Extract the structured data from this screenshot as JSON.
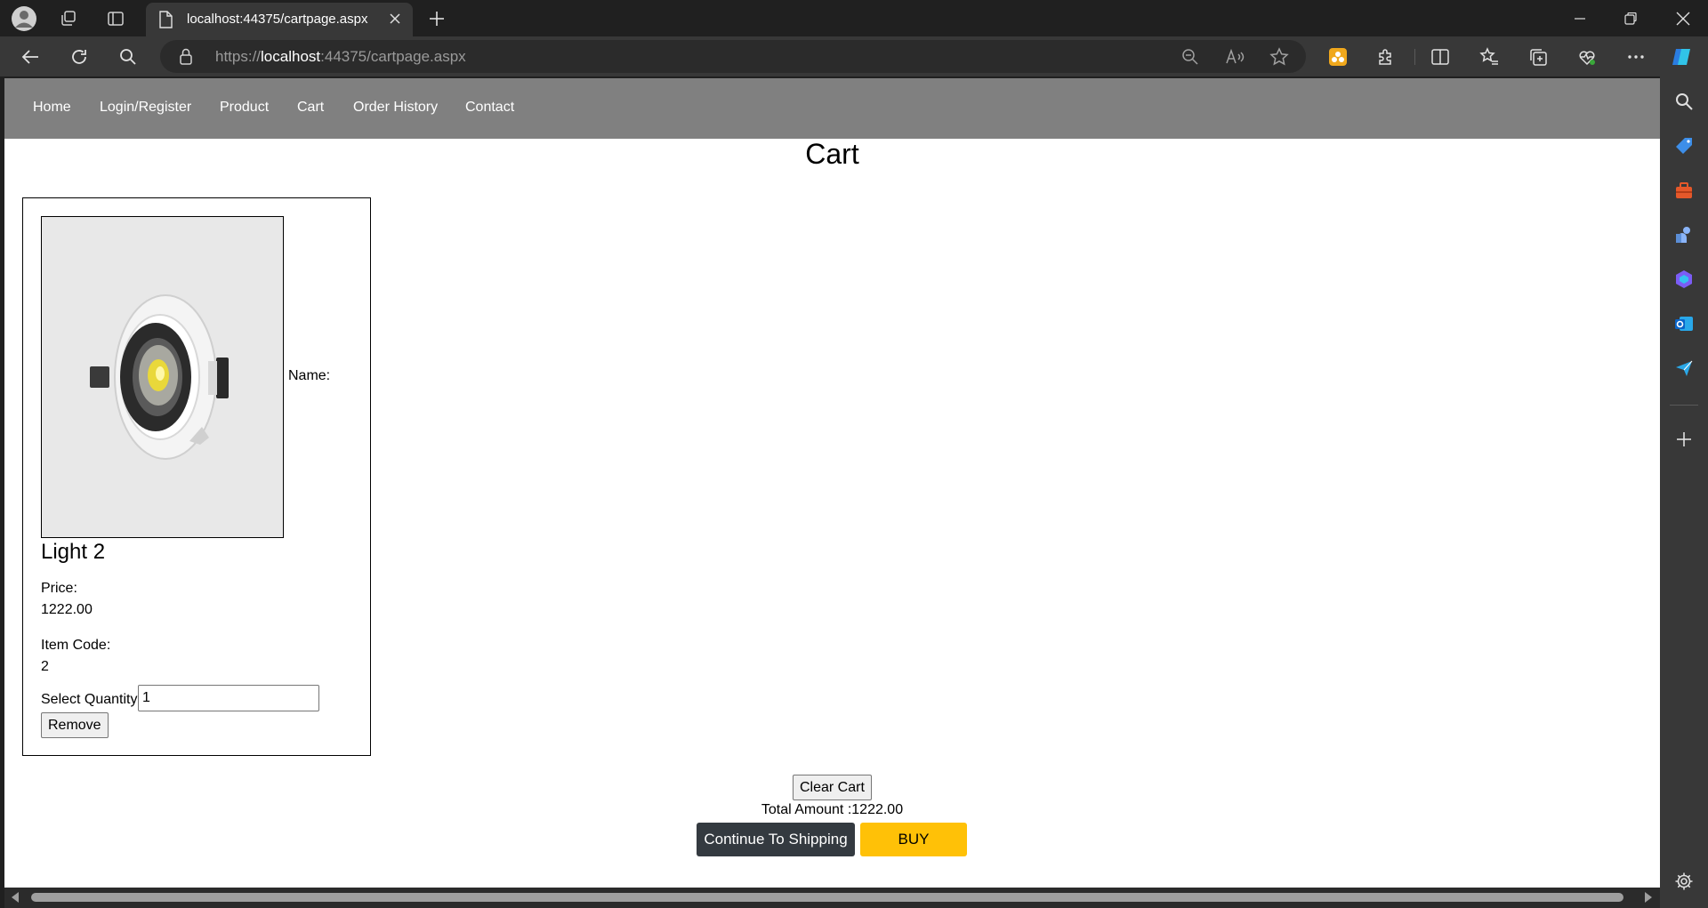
{
  "browser": {
    "tab_title": "localhost:44375/cartpage.aspx",
    "url_scheme": "https://",
    "url_host": "localhost",
    "url_rest": ":44375/cartpage.aspx"
  },
  "nav": {
    "items": [
      "Home",
      "Login/Register",
      "Product",
      "Cart",
      "Order History",
      "Contact"
    ]
  },
  "page": {
    "title": "Cart"
  },
  "cart_item": {
    "name_label": "Name:",
    "product_name": "Light 2",
    "price_label": "Price:",
    "price_value": "1222.00",
    "item_code_label": "Item Code:",
    "item_code_value": "2",
    "quantity_label": "Select Quantity",
    "quantity_value": "1",
    "remove_label": "Remove"
  },
  "actions": {
    "clear_cart_label": "Clear Cart",
    "total_amount_text": "Total Amount :1222.00",
    "continue_label": "Continue To Shipping",
    "buy_label": "BUY"
  },
  "colors": {
    "navbar": "#808080",
    "dark_button": "#343a40",
    "buy_button": "#ffc107"
  }
}
